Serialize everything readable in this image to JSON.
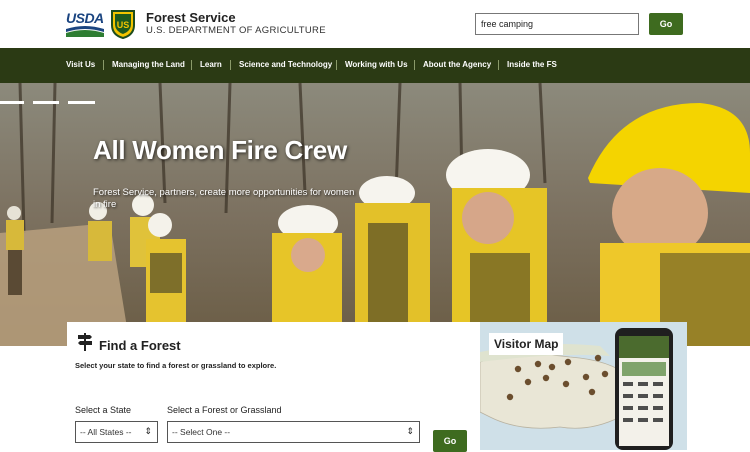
{
  "header": {
    "usda_logo_text": "USDA",
    "agency_name": "Forest Service",
    "agency_subtitle": "U.S. DEPARTMENT OF AGRICULTURE",
    "search_value": "free camping",
    "search_button": "Go",
    "brand_green": "#3e6b1f"
  },
  "nav": {
    "background": "#2b3a14",
    "items": [
      {
        "label": "Visit Us"
      },
      {
        "label": "Managing the Land"
      },
      {
        "label": "Learn"
      },
      {
        "label": "Science and Technology"
      },
      {
        "label": "Working with Us"
      },
      {
        "label": "About the Agency"
      },
      {
        "label": "Inside the FS"
      }
    ]
  },
  "hero": {
    "title": "All Women Fire Crew",
    "subtitle": "Forest Service, partners, create more opportunities for women in fire",
    "slide_count": 3,
    "active_slide": 3
  },
  "find_forest": {
    "icon": "signpost-icon",
    "title": "Find a Forest",
    "description": "Select your state to find a forest or grassland to explore.",
    "state_label": "Select a State",
    "state_value": "-- All States --",
    "forest_label": "Select a Forest or Grassland",
    "forest_value": "-- Select One --",
    "go_label": "Go"
  },
  "visitor_map": {
    "title": "Visitor Map"
  }
}
